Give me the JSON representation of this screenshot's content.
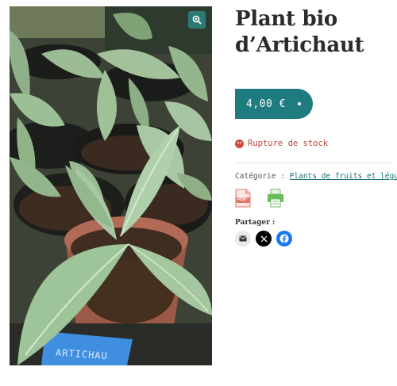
{
  "product": {
    "title_line1": "Plant bio",
    "title_line2": "d’Artichaut",
    "price": "4,00 €",
    "stock_status": "Rupture de stock",
    "category_label": "Catégorie :",
    "category_link": "Plants de fruits et légumes",
    "image_label_text": "ARTICHAU"
  },
  "share": {
    "label": "Partager :",
    "buttons": [
      "email-icon",
      "x-icon",
      "facebook-icon"
    ]
  },
  "icons": {
    "zoom": "zoom-in-icon",
    "pdf": "pdf-icon",
    "pdf_text": "PDF",
    "print": "print-icon",
    "stock": "sad-face-icon"
  },
  "colors": {
    "accent": "#1e7b7f",
    "out_of_stock": "#c0463a",
    "link": "#1e6f73",
    "facebook": "#1877f2"
  }
}
